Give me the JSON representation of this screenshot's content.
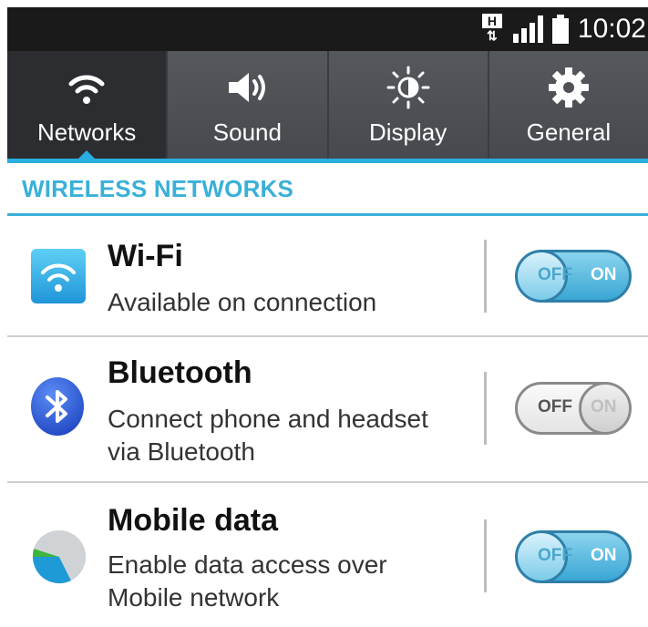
{
  "status_bar": {
    "network_type": "H",
    "network_arrows": "⇅",
    "time": "10:02",
    "icons": [
      "hspa-data-icon",
      "signal-strength-icon",
      "battery-icon"
    ]
  },
  "tabs": [
    {
      "label": "Networks",
      "icon": "wifi-icon",
      "active": true
    },
    {
      "label": "Sound",
      "icon": "speaker-icon",
      "active": false
    },
    {
      "label": "Display",
      "icon": "brightness-icon",
      "active": false
    },
    {
      "label": "General",
      "icon": "gear-icon",
      "active": false
    }
  ],
  "section": {
    "header": "WIRELESS NETWORKS"
  },
  "rows": [
    {
      "title": "Wi-Fi",
      "subtitle_lines": [
        "Available on connection"
      ],
      "icon": "wifi-app-icon",
      "toggle": {
        "state": "on",
        "off_label": "OFF",
        "on_label": "ON"
      }
    },
    {
      "title": "Bluetooth",
      "subtitle_lines": [
        "Connect phone and headset",
        "via Bluetooth"
      ],
      "icon": "bluetooth-icon",
      "toggle": {
        "state": "off",
        "off_label": "OFF",
        "on_label": "ON"
      }
    },
    {
      "title": "Mobile data",
      "subtitle_lines": [
        "Enable data access over",
        "Mobile network"
      ],
      "icon": "mobile-data-icon",
      "toggle": {
        "state": "on",
        "off_label": "OFF",
        "on_label": "ON"
      }
    }
  ],
  "colors": {
    "accent": "#29aee0",
    "section_header": "#3ab0d8",
    "tab_bg": "#4a4d51",
    "active_tab_bg": "#2b2d30"
  }
}
